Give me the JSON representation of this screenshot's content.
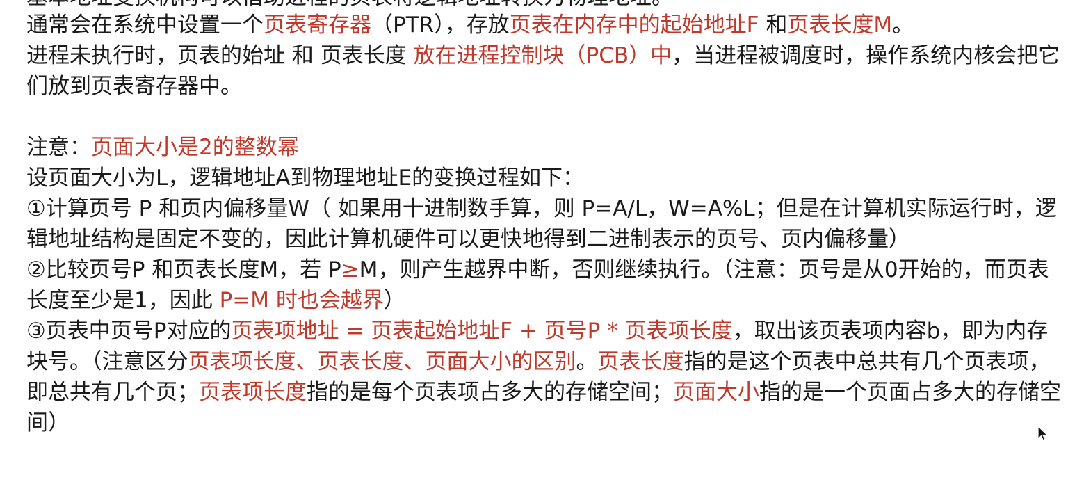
{
  "cut_line": "基本地址变换机构可以借助进程的页表将逻辑地址转换为物理地址。",
  "p1": {
    "s1": "通常会在系统中设置一个",
    "r1": "页表寄存器",
    "s2": "（PTR），存放",
    "r2": "页表在内存中的起始地址F",
    "s3": " 和",
    "r3": "页表长度M",
    "s4": "。",
    "s5": "进程未执行时，页表的始址 和 页表长度 ",
    "r4": "放在进程控制块（PCB）中",
    "s6": "，当进程被调度时，操作系统内核会把它们放到页表寄存器中。"
  },
  "p2": {
    "s1": "注意：",
    "r1": "页面大小是2的整数幂"
  },
  "p3": {
    "s1": "设页面大小为L，逻辑地址A到物理地址E的变换过程如下："
  },
  "p4": {
    "s1": "①计算页号 P 和页内偏移量W（ 如果用十进制数手算，则 P=A/L，W=A%L；但是在计算机实际运行时，逻辑地址结构是固定不变的，因此计算机硬件可以更快地得到二进制表示的页号、页内偏移量）"
  },
  "p5": {
    "s1": "②比较页号P 和页表长度M，若 P",
    "r1": "≥",
    "s2": "M，则产生越界中断，否则继续执行。（注意：页号是从0开始的，而页表长度至少是1，因此 ",
    "r2": "P=M 时也会越界",
    "s3": "）"
  },
  "p6": {
    "s1": "③页表中页号P对应的",
    "r1": "页表项地址 = 页表起始地址F + 页号P * 页表项长度",
    "s2": "，取出该页表项内容b，即为内存块号。（注意区分",
    "r2": "页表项长度、页表长度、页面大小的区别",
    "s3": "。",
    "r3": "页表长度",
    "s4": "指的是这个页表中总共有几个页表项，即总共有几个页；",
    "r4": "页表项长度",
    "s5": "指的是每个页表项占多大的存储空间；",
    "r5": "页面大小",
    "s6": "指的是一个页面占多大的存储空间）"
  },
  "colors": {
    "text": "#1a1a1a",
    "highlight": "#c0392b",
    "background": "#ffffff"
  },
  "icons": {
    "cursor": "mouse-pointer-icon"
  }
}
